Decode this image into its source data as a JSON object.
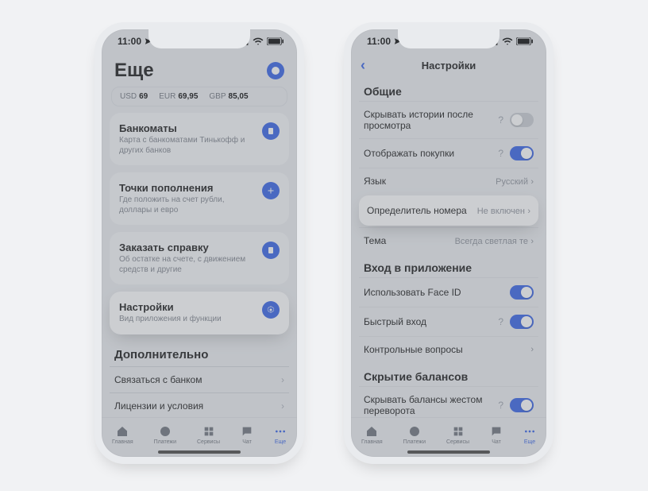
{
  "status": {
    "time": "11:00"
  },
  "left": {
    "title": "Еще",
    "rates": [
      {
        "ccy": "USD",
        "val": "69"
      },
      {
        "ccy": "EUR",
        "val": "69,95"
      },
      {
        "ccy": "GBP",
        "val": "85,05"
      }
    ],
    "cards": [
      {
        "title": "Банкоматы",
        "sub": "Карта с банкоматами Тинькофф и других банков",
        "icon": "atm"
      },
      {
        "title": "Точки пополнения",
        "sub": "Где положить на счет рубли, доллары и евро",
        "icon": "plus"
      },
      {
        "title": "Заказать справку",
        "sub": "Об остатке на счете, с движением средств и другие",
        "icon": "doc"
      },
      {
        "title": "Настройки",
        "sub": "Вид приложения и функции",
        "icon": "gear",
        "hl": true
      }
    ],
    "extra_h": "Дополнительно",
    "extra": [
      "Связаться с банком",
      "Лицензии и условия"
    ]
  },
  "tabs": [
    "Главная",
    "Платежи",
    "Сервисы",
    "Чат",
    "Еще"
  ],
  "right": {
    "nav_title": "Настройки",
    "g1_h": "Общие",
    "g1": [
      {
        "label": "Скрывать истории после просмотра",
        "kind": "toggle",
        "on": false,
        "help": true
      },
      {
        "label": "Отображать покупки",
        "kind": "toggle",
        "on": true,
        "help": true
      },
      {
        "label": "Язык",
        "kind": "val",
        "val": "Русский"
      },
      {
        "label": "Определитель номера",
        "kind": "val",
        "val": "Не включен",
        "hl": true
      },
      {
        "label": "Тема",
        "kind": "val",
        "val": "Всегда светлая те"
      }
    ],
    "g2_h": "Вход в приложение",
    "g2": [
      {
        "label": "Использовать Face ID",
        "kind": "toggle",
        "on": true
      },
      {
        "label": "Быстрый вход",
        "kind": "toggle",
        "on": true,
        "help": true
      },
      {
        "label": "Контрольные вопросы",
        "kind": "chev"
      }
    ],
    "g3_h": "Скрытие балансов",
    "g3": [
      {
        "label": "Скрывать балансы жестом переворота",
        "kind": "toggle",
        "on": true,
        "help": true
      }
    ]
  }
}
